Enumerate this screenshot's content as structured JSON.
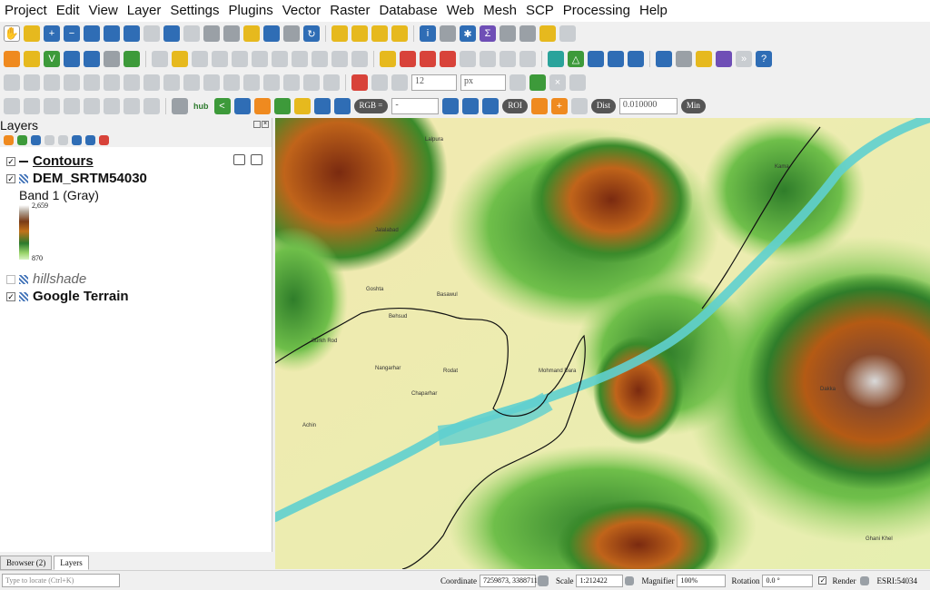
{
  "menu": [
    "Project",
    "Edit",
    "View",
    "Layer",
    "Settings",
    "Plugins",
    "Vector",
    "Raster",
    "Database",
    "Web",
    "Mesh",
    "SCP",
    "Processing",
    "Help"
  ],
  "toolbar": {
    "font_size_value": "12",
    "font_unit": "px",
    "hub_label": "hub",
    "rgb_label": "RGB =",
    "rgb_value": "-",
    "roi_label": "ROI",
    "dist_label": "Dist",
    "dist_value": "0.010000",
    "min_label": "Min"
  },
  "layers_panel": {
    "title": "Layers",
    "layers": [
      {
        "name": "Contours",
        "checked": true,
        "type": "line"
      },
      {
        "name": "DEM_SRTM54030",
        "checked": true,
        "type": "raster"
      },
      {
        "name": "hillshade",
        "checked": false,
        "type": "raster"
      },
      {
        "name": "Google Terrain",
        "checked": true,
        "type": "raster"
      }
    ],
    "band_label": "Band 1 (Gray)",
    "legend_max": "2,659",
    "legend_min": "870"
  },
  "tabs": [
    "Browser (2)",
    "Layers"
  ],
  "map_labels": [
    "Lalpura",
    "Jalalabad",
    "Goshta",
    "Basawul",
    "Behsud",
    "Surkh Rod",
    "Nangarhar",
    "Rodat",
    "Chaparhar",
    "Achin",
    "Kama",
    "Mohmand Dara",
    "Dakka",
    "Ghani Khel"
  ],
  "status": {
    "locator_placeholder": "Type to locate (Ctrl+K)",
    "coordinate_label": "Coordinate",
    "coordinate_value": "7259873, 3388711",
    "scale_label": "Scale",
    "scale_value": "1:212422",
    "magnifier_label": "Magnifier",
    "magnifier_value": "100%",
    "rotation_label": "Rotation",
    "rotation_value": "0.0 °",
    "render_label": "Render",
    "crs_label": "ESRI:54034"
  }
}
